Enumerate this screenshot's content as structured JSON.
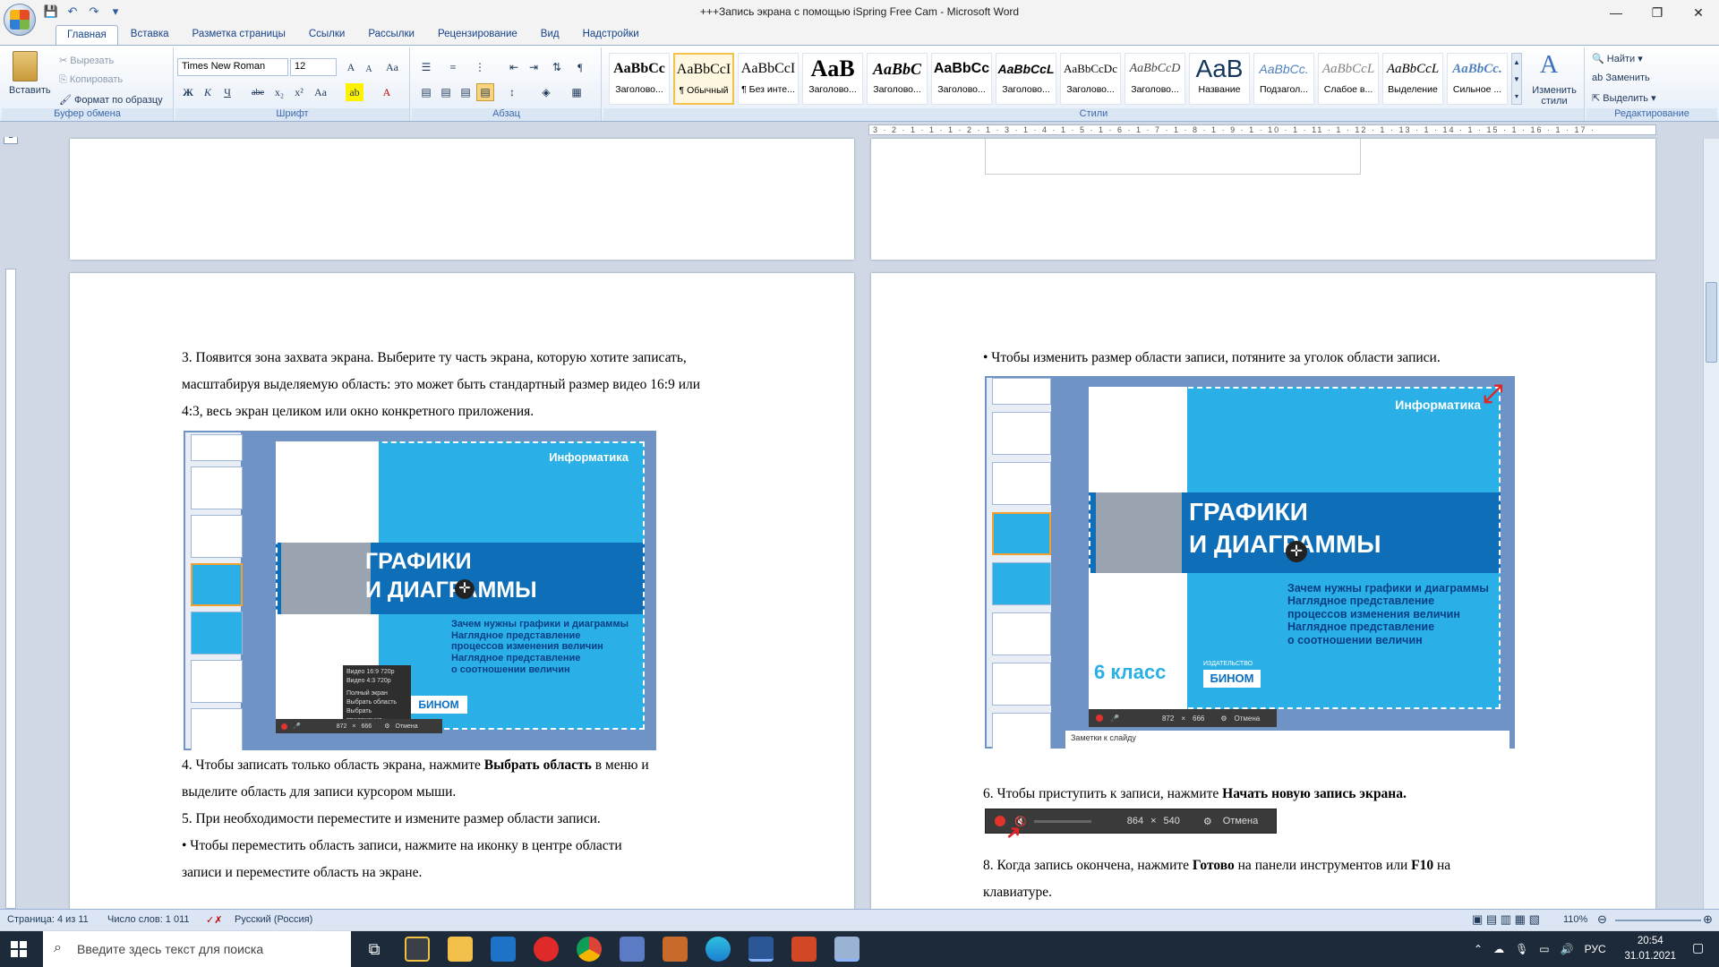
{
  "window": {
    "title": "+++Запись экрана с помощью iSpring Free Cam - Microsoft Word",
    "min": "—",
    "max": "❐",
    "close": "✕"
  },
  "qat": {
    "save": "💾",
    "undo": "↶",
    "redo": "↷",
    "more": "▾"
  },
  "tabs": [
    "Главная",
    "Вставка",
    "Разметка страницы",
    "Ссылки",
    "Рассылки",
    "Рецензирование",
    "Вид",
    "Надстройки"
  ],
  "ribbon": {
    "clipboard": {
      "paste": "Вставить",
      "cut": "Вырезать",
      "copy": "Копировать",
      "format_painter": "Формат по образцу",
      "label": "Буфер обмена"
    },
    "font": {
      "name": "Times New Roman",
      "size": "12",
      "label": "Шрифт",
      "grow": "A",
      "shrink": "A",
      "clear": "Aa",
      "bold": "Ж",
      "italic": "К",
      "underline": "Ч",
      "strike": "abe",
      "sub": "x₂",
      "sup": "x²",
      "case": "Aa",
      "highlight": "ab",
      "color": "A"
    },
    "paragraph": {
      "label": "Абзац",
      "pilcrow": "¶"
    },
    "styles": {
      "label": "Стили",
      "items": [
        {
          "preview": "AaBbCc",
          "name": "Заголово..."
        },
        {
          "preview": "AaBbCcI",
          "name": "¶ Обычный"
        },
        {
          "preview": "AaBbCcI",
          "name": "¶ Без инте..."
        },
        {
          "preview": "AaB",
          "name": "Заголово..."
        },
        {
          "preview": "AaBbC",
          "name": "Заголово..."
        },
        {
          "preview": "AaBbCc",
          "name": "Заголово..."
        },
        {
          "preview": "AaBbCcL",
          "name": "Заголово..."
        },
        {
          "preview": "AaBbCcDc",
          "name": "Заголово..."
        },
        {
          "preview": "AaBbCcD",
          "name": "Заголово..."
        },
        {
          "preview": "AaB",
          "name": "Название"
        },
        {
          "preview": "AaBbCc.",
          "name": "Подзагол..."
        },
        {
          "preview": "AaBbCcL",
          "name": "Слабое в..."
        },
        {
          "preview": "AaBbCcL",
          "name": "Выделение"
        },
        {
          "preview": "AaBbCc.",
          "name": "Сильное ..."
        }
      ],
      "change": "Изменить стили"
    },
    "editing": {
      "find": "Найти",
      "replace": "Заменить",
      "select": "Выделить",
      "label": "Редактирование"
    }
  },
  "ruler": "3 · 2 · 1 · 1 · 1 · 2 · 1 · 3 · 1 · 4 · 1 · 5 · 1 · 6 · 1 · 7 · 1 · 8 · 1 · 9 · 1 · 10 · 1 · 11 · 1 · 12 · 1 · 13 · 1 · 14 · 1 · 15 · 1 · 16 · 1 · 17 ·",
  "left_page": {
    "p3_line1": "3.        Появится зона захвата экрана. Выберите ту часть экрана, которую хотите записать,",
    "p3_line2": "масштабируя выделяемую область: это может быть стандартный размер видео 16:9 или",
    "p3_line3": "4:3, весь экран целиком или окно конкретного приложения.",
    "p4_prefix": "4.        Чтобы записать только область экрана, нажмите ",
    "p4_bold": "Выбрать область",
    "p4_suffix": " в меню и",
    "p4_line2": "выделите область для записи курсором мыши.",
    "p5": "5.        При необходимости переместите и измените размер области записи.",
    "bullet1_line1": "•               Чтобы переместить область записи, нажмите на иконку в центре области",
    "bullet1_line2": "записи и переместите область на экране."
  },
  "right_page": {
    "bullet2": "•               Чтобы изменить размер области записи, потяните за уголок области записи.",
    "p6_prefix": "6.        Чтобы приступить к записи, нажмите ",
    "p6_bold": "Начать новую запись экрана.",
    "p8_prefix": "8.   Когда   запись   окончена,   нажмите ",
    "p8_bold1": "Готово",
    "p8_mid": " на   панели   инструментов   или ",
    "p8_bold2": "F10",
    "p8_suffix": " на",
    "p8_line2": "клавиатуре."
  },
  "slide": {
    "subject": "Информатика",
    "title1": "ГРАФИКИ",
    "title2": "И  ДИАГРАММЫ",
    "sub1": "Зачем нужны графики и диаграммы",
    "sub2": "Наглядное представление",
    "sub3": "процессов изменения величин",
    "sub4": "Наглядное представление",
    "sub5": " о соотношении  величин",
    "grade": "6 класс",
    "grade_short": "6 клас",
    "publisher_small": "ИЗДАТЕЛЬСТВО",
    "publisher": "БИНОМ",
    "notes": "Заметки к слайду"
  },
  "capture_bar": {
    "w": "872",
    "h": "666",
    "x": "×",
    "cancel": "Отмена"
  },
  "capture_bar_big": {
    "w": "864",
    "h": "540",
    "x": "×",
    "cancel": "Отмена"
  },
  "ctx_menu": [
    "Видео 16:9 720p",
    "Видео 4:3 720p",
    "Полный экран",
    "Выбрать область",
    "Выбрать приложение  ▸"
  ],
  "status": {
    "page": "Страница: 4 из 11",
    "words": "Число слов: 1 011",
    "lang": "Русский (Россия)",
    "zoom": "110%"
  },
  "taskbar": {
    "search_placeholder": "Введите здесь текст для поиска",
    "lang": "РУС",
    "time": "20:54",
    "date": "31.01.2021"
  }
}
